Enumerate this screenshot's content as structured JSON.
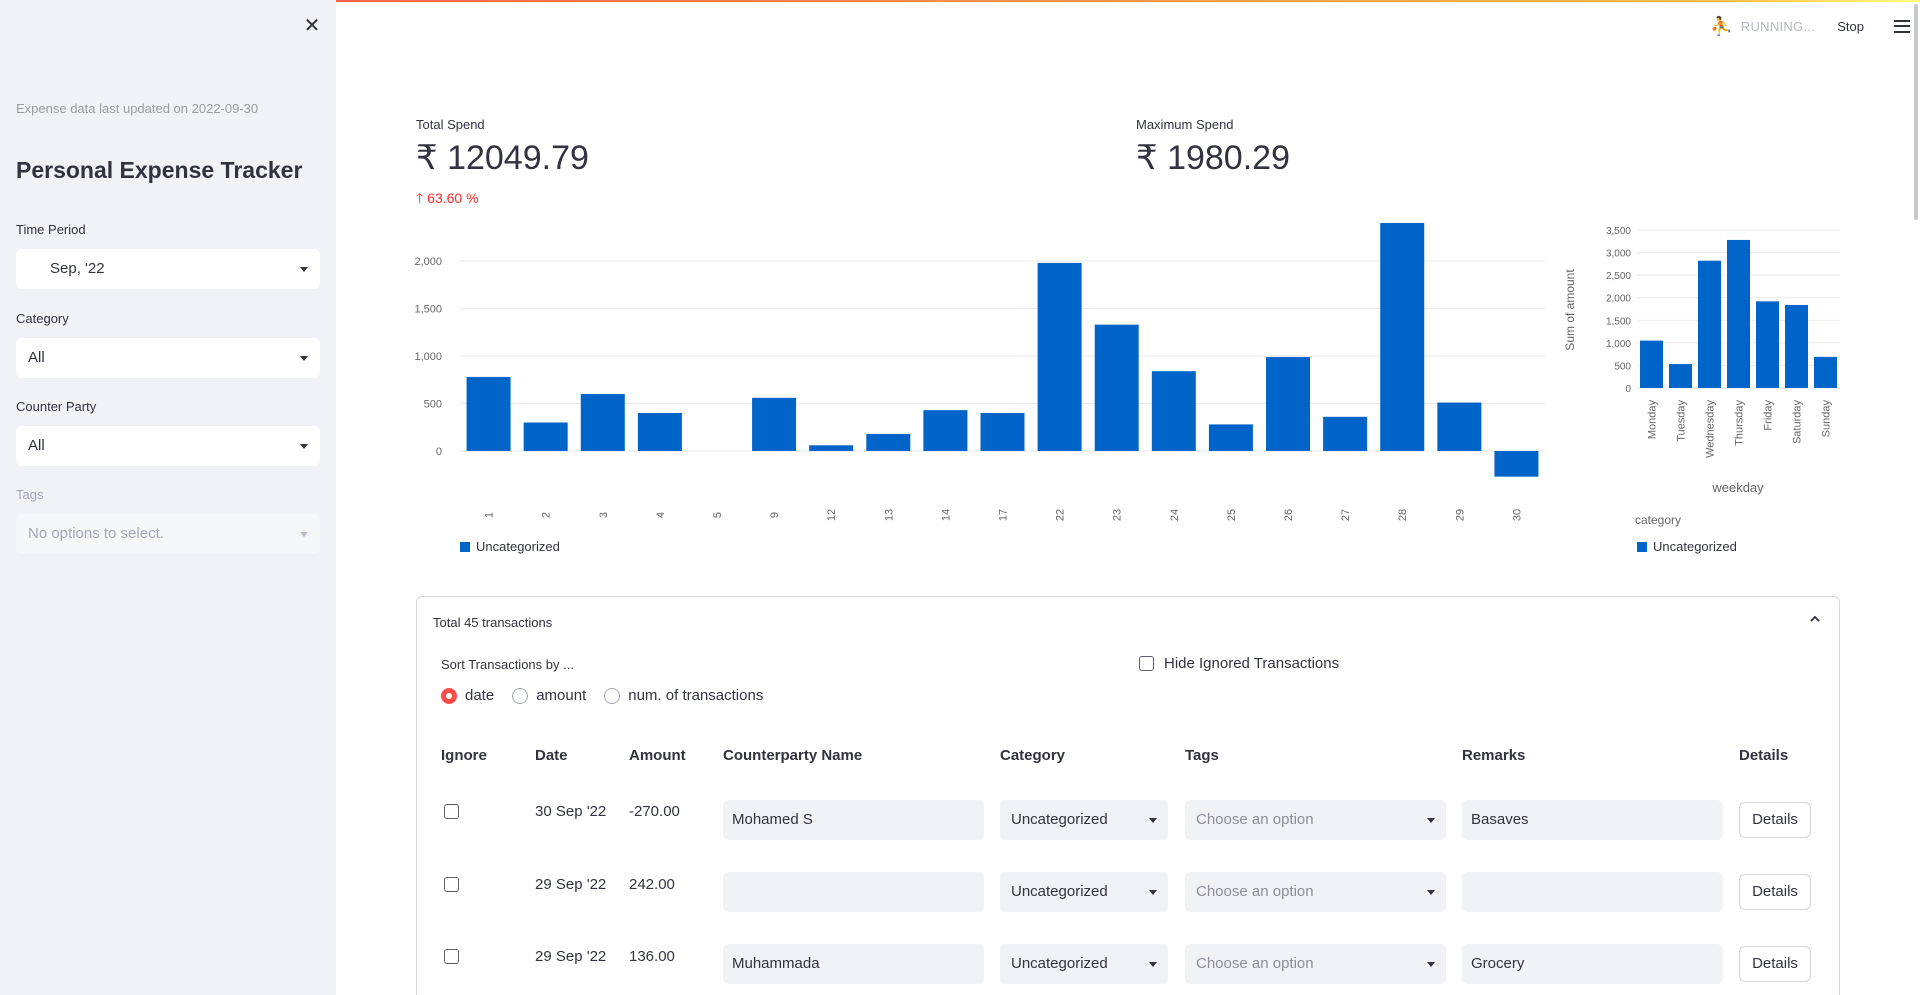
{
  "header": {
    "running": "RUNNING...",
    "stop": "Stop"
  },
  "sidebar": {
    "updated": "Expense data last updated on 2022-09-30",
    "title": "Personal Expense Tracker",
    "time_period_label": "Time Period",
    "time_period_value": "Sep, '22",
    "category_label": "Category",
    "category_value": "All",
    "counter_party_label": "Counter Party",
    "counter_party_value": "All",
    "tags_label": "Tags",
    "tags_placeholder": "No options to select."
  },
  "metrics": {
    "total_label": "Total Spend",
    "total_value": "₹ 12049.79",
    "total_delta": "63.60 %",
    "max_label": "Maximum Spend",
    "max_value": "₹ 1980.29"
  },
  "chart_data": [
    {
      "type": "bar",
      "categories": [
        "1",
        "2",
        "3",
        "4",
        "5",
        "9",
        "12",
        "13",
        "14",
        "17",
        "22",
        "23",
        "24",
        "25",
        "26",
        "27",
        "28",
        "29",
        "30"
      ],
      "series": [
        {
          "name": "Uncategorized",
          "values": [
            780,
            300,
            600,
            400,
            0,
            560,
            60,
            180,
            430,
            400,
            1980,
            1330,
            840,
            280,
            990,
            360,
            2400,
            510,
            -270
          ],
          "color": "#0064c8"
        }
      ],
      "yticks": [
        "0",
        "500",
        "1,000",
        "1,500",
        "2,000"
      ],
      "ylim": [
        -400,
        2400
      ],
      "grid": true,
      "legend": "bottom-left"
    },
    {
      "type": "bar",
      "categories": [
        "Monday",
        "Tuesday",
        "Wednesday",
        "Thursday",
        "Friday",
        "Saturday",
        "Sunday"
      ],
      "series": [
        {
          "name": "Uncategorized",
          "values": [
            1050,
            530,
            2820,
            3280,
            1920,
            1840,
            690
          ],
          "color": "#0064c8"
        }
      ],
      "yticks": [
        "0",
        "500",
        "1,000",
        "1,500",
        "2,000",
        "2,500",
        "3,000",
        "3,500"
      ],
      "ylim": [
        0,
        3500
      ],
      "xlabel": "weekday",
      "ylabel": "Sum of amount",
      "legend_title": "category",
      "grid": true,
      "legend": "bottom-left"
    }
  ],
  "transactions": {
    "title": "Total 45 transactions",
    "sort_label": "Sort Transactions by ...",
    "sort_options": [
      "date",
      "amount",
      "num. of transactions"
    ],
    "sort_selected": "date",
    "hide_ignored": "Hide Ignored Transactions",
    "headers": [
      "Ignore",
      "Date",
      "Amount",
      "Counterparty Name",
      "Category",
      "Tags",
      "Remarks",
      "Details"
    ],
    "rows": [
      {
        "date": "30 Sep '22",
        "amount": "-270.00",
        "counterparty": "Mohamed S",
        "category": "Uncategorized",
        "tags": "Choose an option",
        "remarks": "Basaves",
        "details": "Details"
      },
      {
        "date": "29 Sep '22",
        "amount": "242.00",
        "counterparty": "",
        "category": "Uncategorized",
        "tags": "Choose an option",
        "remarks": "",
        "details": "Details"
      },
      {
        "date": "29 Sep '22",
        "amount": "136.00",
        "counterparty": "Muhammada",
        "category": "Uncategorized",
        "tags": "Choose an option",
        "remarks": "Grocery",
        "details": "Details"
      }
    ]
  }
}
